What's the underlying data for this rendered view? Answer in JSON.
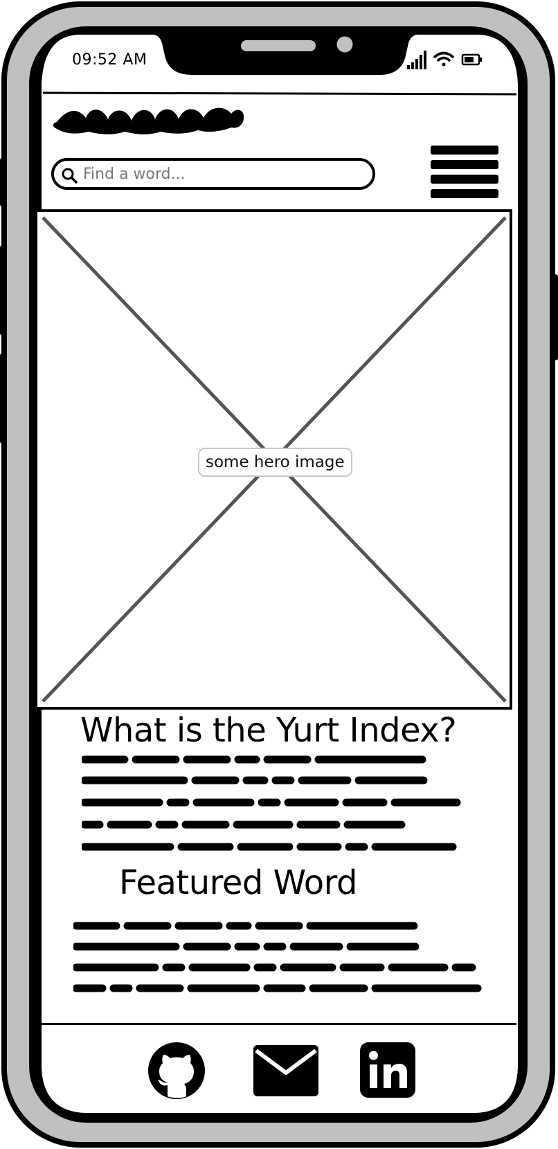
{
  "status_bar": {
    "time": "09:52 AM"
  },
  "header": {
    "search": {
      "placeholder": "Find a word..."
    }
  },
  "hero": {
    "label": "some hero image"
  },
  "intro": {
    "title": "What is the Yurt Index?"
  },
  "featured": {
    "title": "Featured Word"
  },
  "footer": {
    "links": [
      "github-icon",
      "mail-icon",
      "linkedin-icon"
    ]
  },
  "colors": {
    "frame": "#000000",
    "bezel": "#c0c0c0",
    "screen": "#ffffff",
    "placeholder_cross": "#555555"
  }
}
